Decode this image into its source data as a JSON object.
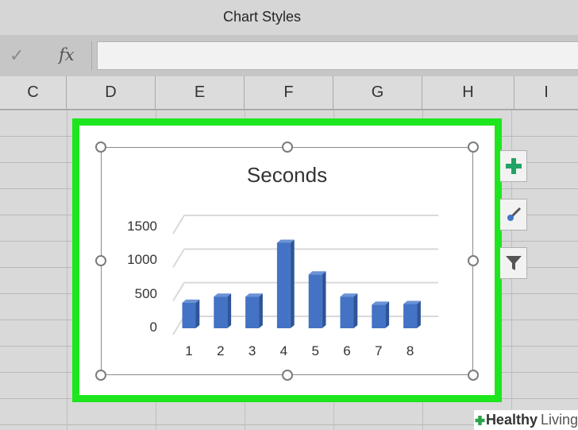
{
  "window": {
    "title": "Chart Styles"
  },
  "formula_bar": {
    "enter_icon": "✓",
    "function_icon": "fx",
    "content": ""
  },
  "columns": [
    "C",
    "D",
    "E",
    "F",
    "G",
    "H",
    "I"
  ],
  "side_buttons": [
    {
      "name": "chart-elements-button",
      "icon": "plus-icon"
    },
    {
      "name": "chart-styles-button",
      "icon": "paintbrush-icon"
    },
    {
      "name": "chart-filters-button",
      "icon": "funnel-icon"
    }
  ],
  "chart_data": {
    "type": "bar",
    "title": "Seconds",
    "categories": [
      "1",
      "2",
      "3",
      "4",
      "5",
      "6",
      "7",
      "8"
    ],
    "values": [
      380,
      470,
      470,
      1270,
      800,
      470,
      350,
      360
    ],
    "ylim": [
      0,
      1500
    ],
    "yticks": [
      "0",
      "500",
      "1000",
      "1500"
    ],
    "grid": true,
    "legend": "none",
    "bar_color": "#4472c4"
  },
  "watermark": {
    "bold": "Healthy",
    "light": "Living"
  },
  "colors": {
    "selection": "#1ee61e",
    "bar": "#4472c4",
    "plus": "#21a366"
  }
}
